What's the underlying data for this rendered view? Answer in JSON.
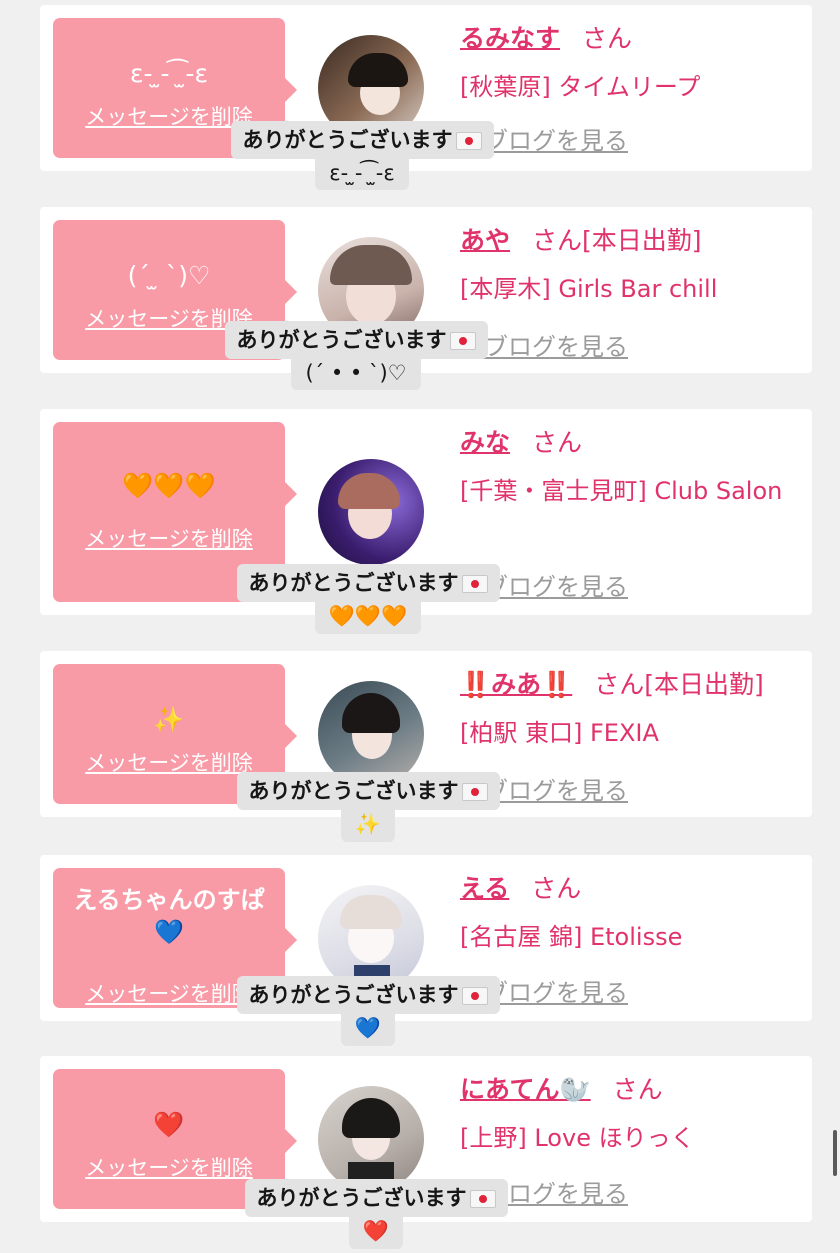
{
  "common": {
    "delete_label": "メッセージを削除",
    "blog_label": "のブログを見る",
    "san": "さん",
    "thanks": "ありがとうございます"
  },
  "cards": [
    {
      "name": "るみなす",
      "status": "",
      "shop": "[秋葉原] タイムリープ",
      "message": "ε- ̫- ͡ ̫-ε",
      "reaction": "ε- ̫- ͡ ̫-ε"
    },
    {
      "name": "あや",
      "status": "[本日出勤]",
      "shop": "[本厚木] Girls Bar chill",
      "message": "(ˊ ̫ ˋ)♡",
      "reaction": "(ˊ • • ˋ)♡"
    },
    {
      "name": "みな",
      "status": "",
      "shop": "[千葉・富士見町] Club Salon",
      "message": "🧡🧡🧡",
      "reaction": "🧡🧡🧡"
    },
    {
      "name": "‼️みあ‼️",
      "status": "[本日出勤]",
      "shop": "[柏駅 東口] FEXIA",
      "message": "✨",
      "reaction": "✨"
    },
    {
      "name": "える",
      "status": "",
      "shop": "[名古屋 錦] Etolisse",
      "message": "えるちゃんのすぱ",
      "message_line2": "💙",
      "reaction": "💙"
    },
    {
      "name": "にあてん🦭",
      "status": "",
      "shop": "[上野] Love ほりっく",
      "message": "❤️",
      "reaction": "❤️"
    }
  ],
  "colors": {
    "accent": "#e0336b",
    "bubble": "#f99aa7",
    "muted": "#9b9b9b",
    "background": "#f1f0f0"
  }
}
